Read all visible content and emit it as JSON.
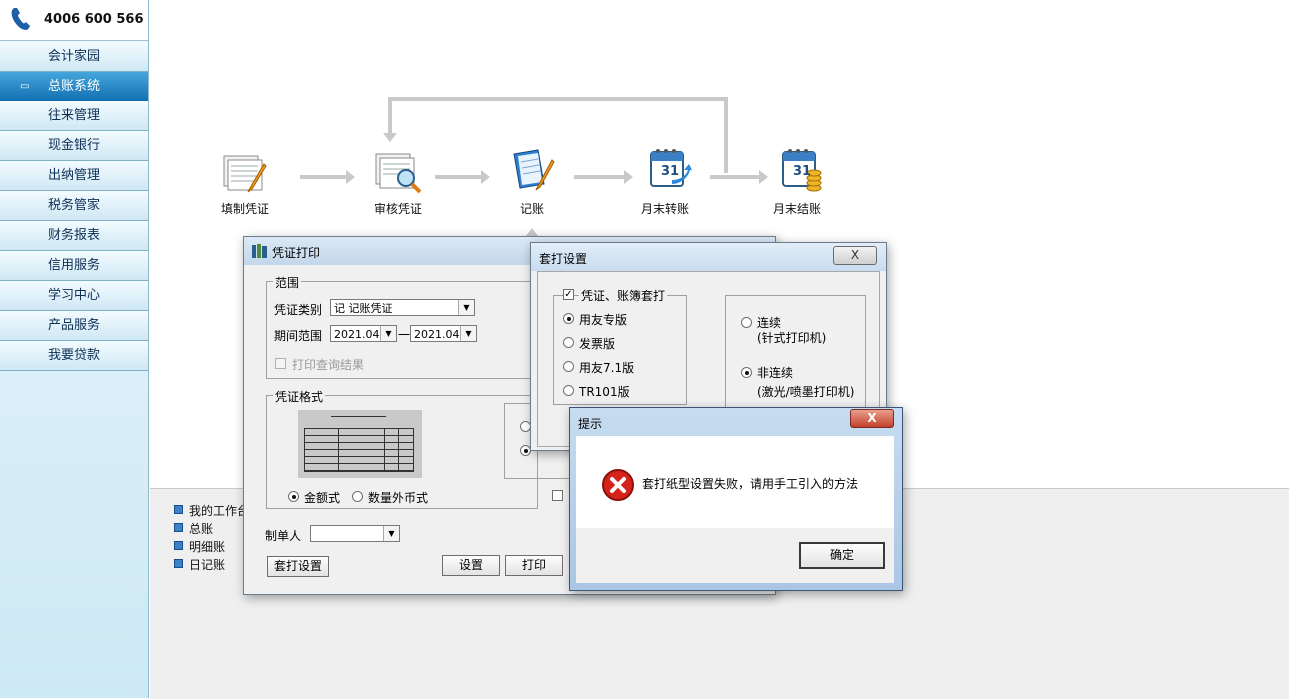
{
  "sidebar": {
    "phone": "4006 600 566",
    "items": [
      {
        "label": "会计家园"
      },
      {
        "label": "总账系统",
        "active": true
      },
      {
        "label": "往来管理"
      },
      {
        "label": "现金银行"
      },
      {
        "label": "出纳管理"
      },
      {
        "label": "税务管家"
      },
      {
        "label": "财务报表"
      },
      {
        "label": "信用服务"
      },
      {
        "label": "学习中心"
      },
      {
        "label": "产品服务"
      },
      {
        "label": "我要贷款"
      }
    ]
  },
  "workflow": {
    "steps": [
      "填制凭证",
      "审核凭证",
      "记账",
      "月末转账",
      "月末结账"
    ],
    "calendar_day": "31"
  },
  "bottom_list": [
    "我的工作台",
    "总账",
    "明细账",
    "日记账"
  ],
  "print_dialog": {
    "title": "凭证打印",
    "range_group": "范围",
    "voucher_type_label": "凭证类别",
    "voucher_type_value": "记    记账凭证",
    "period_label": "期间范围",
    "period_from": "2021.04",
    "period_sep": "一",
    "period_to": "2021.04",
    "print_query_result": "打印查询结果",
    "format_group": "凭证格式",
    "format_amount": "金额式",
    "format_quantity": "数量外币式",
    "maker_label": "制单人",
    "btn_set_print": "套打设置",
    "btn_settings": "设置",
    "btn_print": "打印"
  },
  "overlay_dialog": {
    "title": "套打设置",
    "close": "X",
    "check_label": "凭证、账簿套打",
    "options": [
      "用友专版",
      "发票版",
      "用友7.1版",
      "TR101版"
    ],
    "continuous": "连续",
    "continuous_sub": "(针式打印机)",
    "non_continuous": "非连续",
    "non_continuous_sub": "(激光/喷墨打印机)"
  },
  "alert": {
    "title": "提示",
    "close": "X",
    "message": "套打纸型设置失败，请用手工引入的方法",
    "ok": "确定"
  }
}
